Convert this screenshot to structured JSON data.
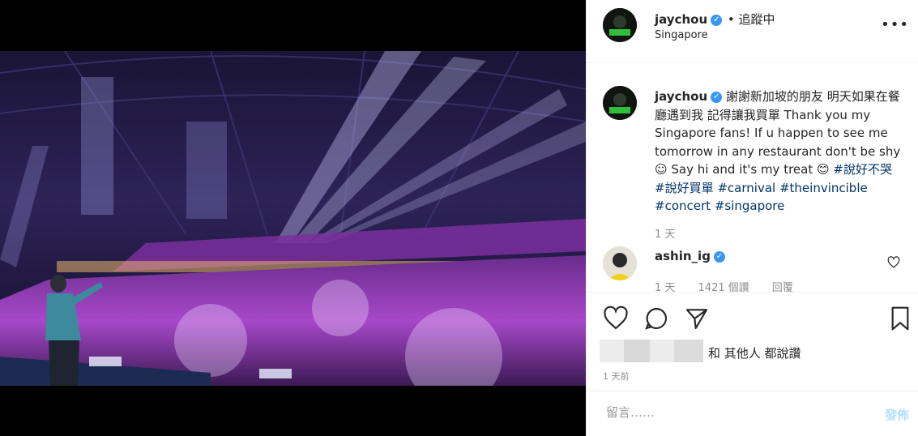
{
  "colors": {
    "link": "#003569",
    "verified": "#3897f0",
    "post_disabled": "#b2dffc",
    "muted": "#8e8e8e",
    "stage_purple": "#b04fd8"
  },
  "post": {
    "author": "jaychou",
    "follow_status": "• 追蹤中",
    "location": "Singapore",
    "more_icon": "more-horizontal-icon",
    "caption_text": "謝謝新加坡的朋友 明天如果在餐廳遇到我 記得讓我買單 Thank you my Singapore fans! If u happen to see me tomorrow in any restaurant don't be shy ☺ Say hi and it's my treat 😊",
    "hashtags": [
      "#說好不哭",
      "#說好買單",
      "#carnival",
      "#theinvincible",
      "#concert",
      "#singapore"
    ],
    "caption_time": "1 天",
    "liked_by_suffix": "和 其他人 都說讚",
    "post_time": "1 天前"
  },
  "comment": {
    "author": "ashin_ig",
    "meta": [
      "1 天",
      "1421 個讚",
      "回覆"
    ]
  },
  "actions": {
    "like_icon": "heart-icon",
    "comment_icon": "comment-icon",
    "share_icon": "share-icon",
    "save_icon": "bookmark-icon"
  },
  "comment_input": {
    "placeholder": "留言……",
    "post_label": "發佈"
  }
}
